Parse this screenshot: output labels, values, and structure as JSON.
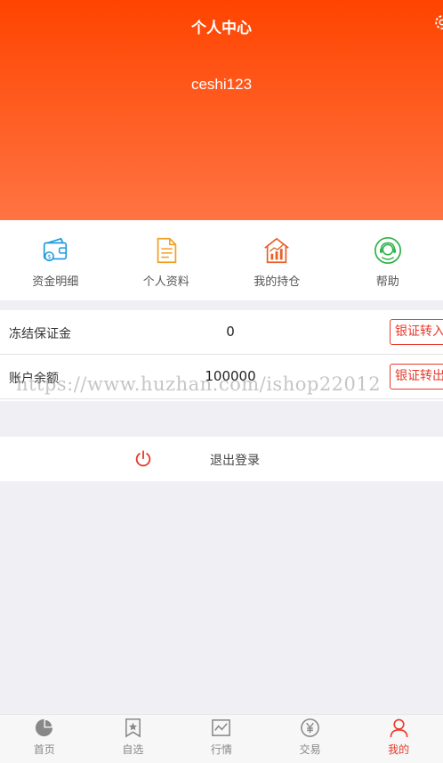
{
  "header": {
    "title": "个人中心",
    "username": "ceshi123"
  },
  "quick_menu": [
    {
      "label": "资金明细",
      "icon": "wallet-icon"
    },
    {
      "label": "个人资料",
      "icon": "document-icon"
    },
    {
      "label": "我的持仓",
      "icon": "holdings-chart-icon"
    },
    {
      "label": "帮助",
      "icon": "help-support-icon"
    }
  ],
  "account": {
    "frozen_label": "冻结保证金",
    "frozen_value": "0",
    "transfer_in_label": "银证转入",
    "balance_label": "账户余额",
    "balance_value": "100000",
    "transfer_out_label": "银证转出"
  },
  "watermark": "https://www.huzhan.com/ishop22012",
  "logout": {
    "label": "退出登录"
  },
  "tabbar": [
    {
      "label": "首页",
      "icon": "pie-chart-icon",
      "active": false
    },
    {
      "label": "自选",
      "icon": "bookmark-star-icon",
      "active": false
    },
    {
      "label": "行情",
      "icon": "trend-chart-icon",
      "active": false
    },
    {
      "label": "交易",
      "icon": "yuan-coin-icon",
      "active": false
    },
    {
      "label": "我的",
      "icon": "person-icon",
      "active": true
    }
  ],
  "colors": {
    "header_top": "#ff4400",
    "header_bottom": "#ff7443",
    "accent": "#e83a2c"
  }
}
